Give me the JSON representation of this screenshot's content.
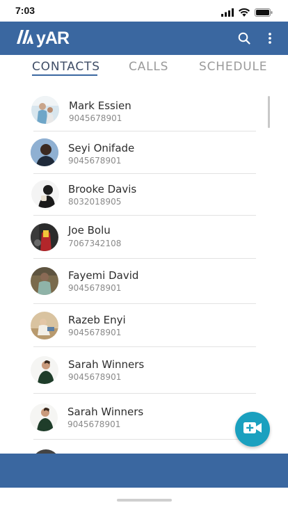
{
  "status_bar": {
    "time": "7:03"
  },
  "app_bar": {
    "logo_text": "yAR",
    "background": "#3a67a0",
    "icons": [
      "search-icon",
      "more-vert-icon"
    ]
  },
  "tabs": [
    {
      "label": "CONTACTS",
      "active": true
    },
    {
      "label": "CALLS",
      "active": false
    },
    {
      "label": "SCHEDULE",
      "active": false
    }
  ],
  "contacts": [
    {
      "name": "Mark Essien",
      "phone": "9045678901"
    },
    {
      "name": "Seyi Onifade",
      "phone": "9045678901"
    },
    {
      "name": "Brooke Davis",
      "phone": "8032018905"
    },
    {
      "name": "Joe Bolu",
      "phone": "7067342108"
    },
    {
      "name": "Fayemi David",
      "phone": "9045678901"
    },
    {
      "name": "Razeb Enyi",
      "phone": "9045678901"
    },
    {
      "name": "Sarah Winners",
      "phone": "9045678901"
    },
    {
      "name": "Sarah Winners",
      "phone": "9045678901"
    }
  ],
  "fab": {
    "icon": "video-add-icon",
    "color": "#1aa0bf"
  }
}
